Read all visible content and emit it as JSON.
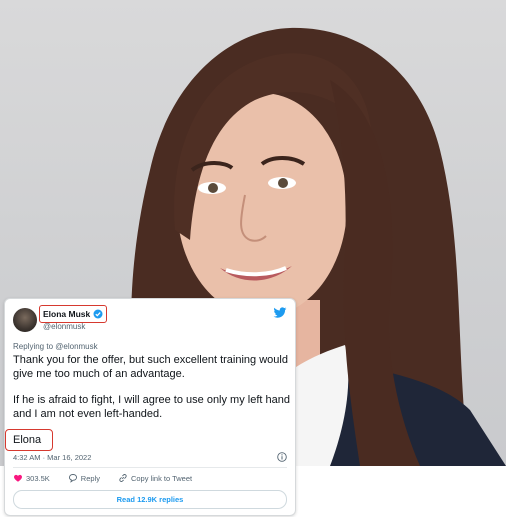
{
  "tweet": {
    "author_name": "Elona Musk",
    "handle": "@elonmusk",
    "replying_prefix": "Replying to",
    "replying_handle": "@elonmusk",
    "paragraph1": "Thank you for the offer, but such excellent training would give me too much of an advantage.",
    "paragraph2": "If he is afraid to fight, I will agree to use only my left hand and I am not even left-handed.",
    "signature": "Elona",
    "timestamp": "4:32 AM · Mar 16, 2022",
    "likes": "303.5K",
    "reply_label": "Reply",
    "copy_link_label": "Copy link to Tweet",
    "read_replies_label": "Read 12.9K replies"
  },
  "icons": {
    "verified": "verified-badge-icon",
    "logo": "twitter-bird-icon",
    "info": "info-icon",
    "like": "heart-icon",
    "reply": "reply-icon",
    "copy": "link-icon"
  },
  "colors": {
    "twitter_blue": "#1d9bf0",
    "highlight_red": "#d6392f",
    "like_red": "#f91880"
  }
}
